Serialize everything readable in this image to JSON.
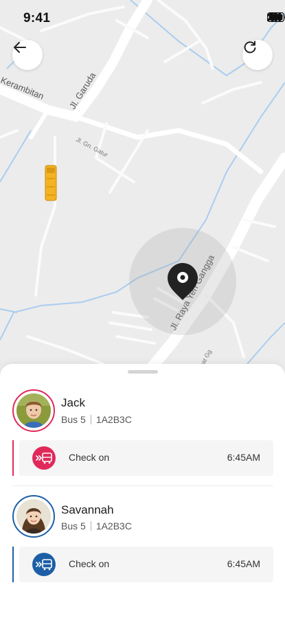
{
  "status_bar": {
    "time": "9:41"
  },
  "map": {
    "street_labels": [
      "Kerambitan",
      "Jl. Garuda",
      "Jl. Gn. Gatur",
      "Jl. Raya Yeh Gangga",
      "Jl. Pagat Gg"
    ]
  },
  "children": [
    {
      "name": "Jack",
      "bus": "Bus 5",
      "plate": "1A2B3C",
      "ring_color": "#e0295a",
      "event": {
        "label": "Check on",
        "time": "6:45AM",
        "icon": "bus-arrival-icon"
      }
    },
    {
      "name": "Savannah",
      "bus": "Bus 5",
      "plate": "1A2B3C",
      "ring_color": "#1d5fa6",
      "event": {
        "label": "Check on",
        "time": "6:45AM",
        "icon": "bus-arrival-icon"
      }
    }
  ],
  "colors": {
    "accent_pink": "#e0295a",
    "accent_blue": "#1d5fa6",
    "bus": "#f4b322",
    "map_bg": "#ececec",
    "water": "#a9cdf0"
  }
}
